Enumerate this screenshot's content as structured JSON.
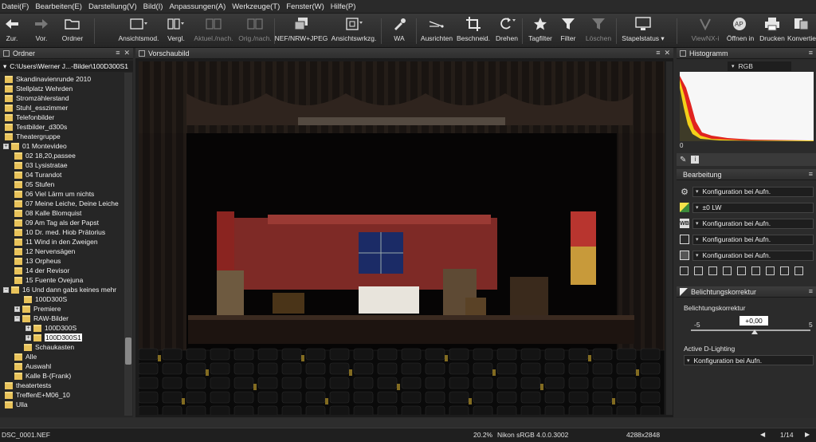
{
  "menu": [
    "Datei(F)",
    "Bearbeiten(E)",
    "Darstellung(V)",
    "Bild(I)",
    "Anpassungen(A)",
    "Werkzeuge(T)",
    "Fenster(W)",
    "Hilfe(P)"
  ],
  "toolbar": {
    "zur": "Zur.",
    "vor": "Vor.",
    "ordner": "Ordner",
    "ansichtsmod": "Ansichtsmod.",
    "vergl": "Vergl.",
    "aktuel": "Aktuel./nach.",
    "orig": "Orig./nach.",
    "nef": "NEF/NRW+JPEG",
    "ansichtswrkzg": "Ansichtswrkzg.",
    "wa": "WA",
    "ausrichten": "Ausrichten",
    "beschneid": "Beschneid.",
    "drehen": "Drehen",
    "tagfilter": "Tagfilter",
    "filter": "Filter",
    "loeschen": "Löschen",
    "stapelstatus": "Stapelstatus",
    "viewnx": "ViewNX-i",
    "oeffnen": "Öffnen in",
    "drucken": "Drucken",
    "konvertie": "Konvertie"
  },
  "left_panel": {
    "title": "Ordner",
    "path": "C:\\Users\\Werner J...-Bilder\\100D300S1",
    "items": [
      {
        "label": "Skandinavienrunde 2010"
      },
      {
        "label": "Stellplatz Wehrden"
      },
      {
        "label": "Stromzählerstand"
      },
      {
        "label": "Stuhl_esszimmer"
      },
      {
        "label": "Telefonbilder"
      },
      {
        "label": "Testbilder_d300s"
      },
      {
        "label": "Theatergruppe"
      },
      {
        "label": "01 Montevideo"
      },
      {
        "label": "02 18,20,passee"
      },
      {
        "label": "03 Lysistratae"
      },
      {
        "label": "04 Turandot"
      },
      {
        "label": "05 Stufen"
      },
      {
        "label": "06 Viel Lärm um nichts"
      },
      {
        "label": "07 Meine Leiche, Deine Leiche"
      },
      {
        "label": "08 Kalle Blomquist"
      },
      {
        "label": "09 Am Tag als der Papst"
      },
      {
        "label": "10 Dr. med. Hiob Prätorius"
      },
      {
        "label": "11 Wind in den Zweigen"
      },
      {
        "label": "12 Nervensägen"
      },
      {
        "label": "13 Orpheus"
      },
      {
        "label": "14 der Revisor"
      },
      {
        "label": "15 Fuente Ovejuna"
      },
      {
        "label": "16 Und dann gabs keines mehr"
      },
      {
        "label": "100D300S"
      },
      {
        "label": "Premiere"
      },
      {
        "label": "RAW-Bilder"
      },
      {
        "label": "100D300S"
      },
      {
        "label": "100D300S1"
      },
      {
        "label": "Schaukasten"
      },
      {
        "label": "Alle"
      },
      {
        "label": "Auswahl"
      },
      {
        "label": "Kalle B-(Frank)"
      },
      {
        "label": "theatertests"
      },
      {
        "label": "TreffenE+M06_10"
      },
      {
        "label": "Ulla"
      }
    ]
  },
  "center_panel": {
    "title": "Vorschaubild"
  },
  "right_panel": {
    "histogram_title": "Histogramm",
    "channel": "RGB",
    "histo_zero": "0",
    "bearbeitung_title": "Bearbeitung",
    "rows": [
      "Konfiguration bei Aufn.",
      "±0 LW",
      "Konfiguration bei Aufn.",
      "Konfiguration bei Aufn.",
      "Konfiguration bei Aufn."
    ],
    "belichtung_title": "Belichtungskorrektur",
    "belichtung_label": "Belichtungskorrektur",
    "slider_min": "-5",
    "slider_value": "+0,00",
    "slider_max": "5",
    "adl_label": "Active D-Lighting",
    "adl_value": "Konfiguration bei Aufn."
  },
  "status": {
    "filename": "DSC_0001.NEF",
    "zoom": "20.2%",
    "profile": "Nikon sRGB 4.0.0.3002",
    "dimensions": "4288x2848",
    "page": "1/14"
  }
}
